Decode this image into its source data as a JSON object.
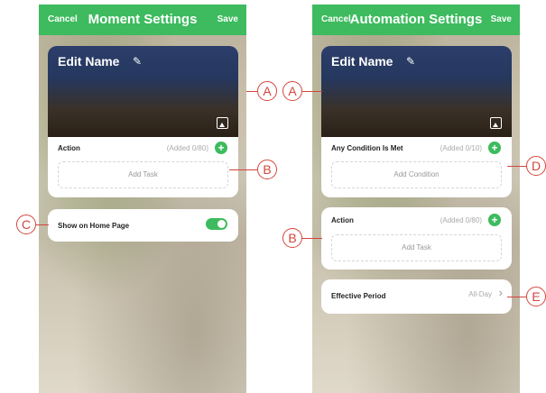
{
  "left": {
    "cancel": "Cancel",
    "title": "Moment Settings",
    "save": "Save",
    "cover_name": "Edit Name",
    "action": {
      "label": "Action",
      "count": "(Added 0/80)",
      "add": "Add Task"
    },
    "home_toggle": {
      "label": "Show on Home Page",
      "on": true
    }
  },
  "right": {
    "cancel": "Cancel",
    "title": "Automation Settings",
    "save": "Save",
    "cover_name": "Edit Name",
    "condition": {
      "label": "Any Condition Is Met",
      "count": "(Added 0/10)",
      "add": "Add Condition"
    },
    "action": {
      "label": "Action",
      "count": "(Added 0/80)",
      "add": "Add Task"
    },
    "period": {
      "label": "Effective Period",
      "value": "All-Day"
    }
  },
  "callouts": {
    "a1": "A",
    "a2": "A",
    "b1": "B",
    "b2": "B",
    "c": "C",
    "d": "D",
    "e": "E"
  },
  "icons": [
    "pencil-icon",
    "image-icon",
    "plus-icon",
    "chevron-right-icon"
  ],
  "colors": {
    "accent": "#3dbb5e",
    "callout": "#d2463c"
  }
}
